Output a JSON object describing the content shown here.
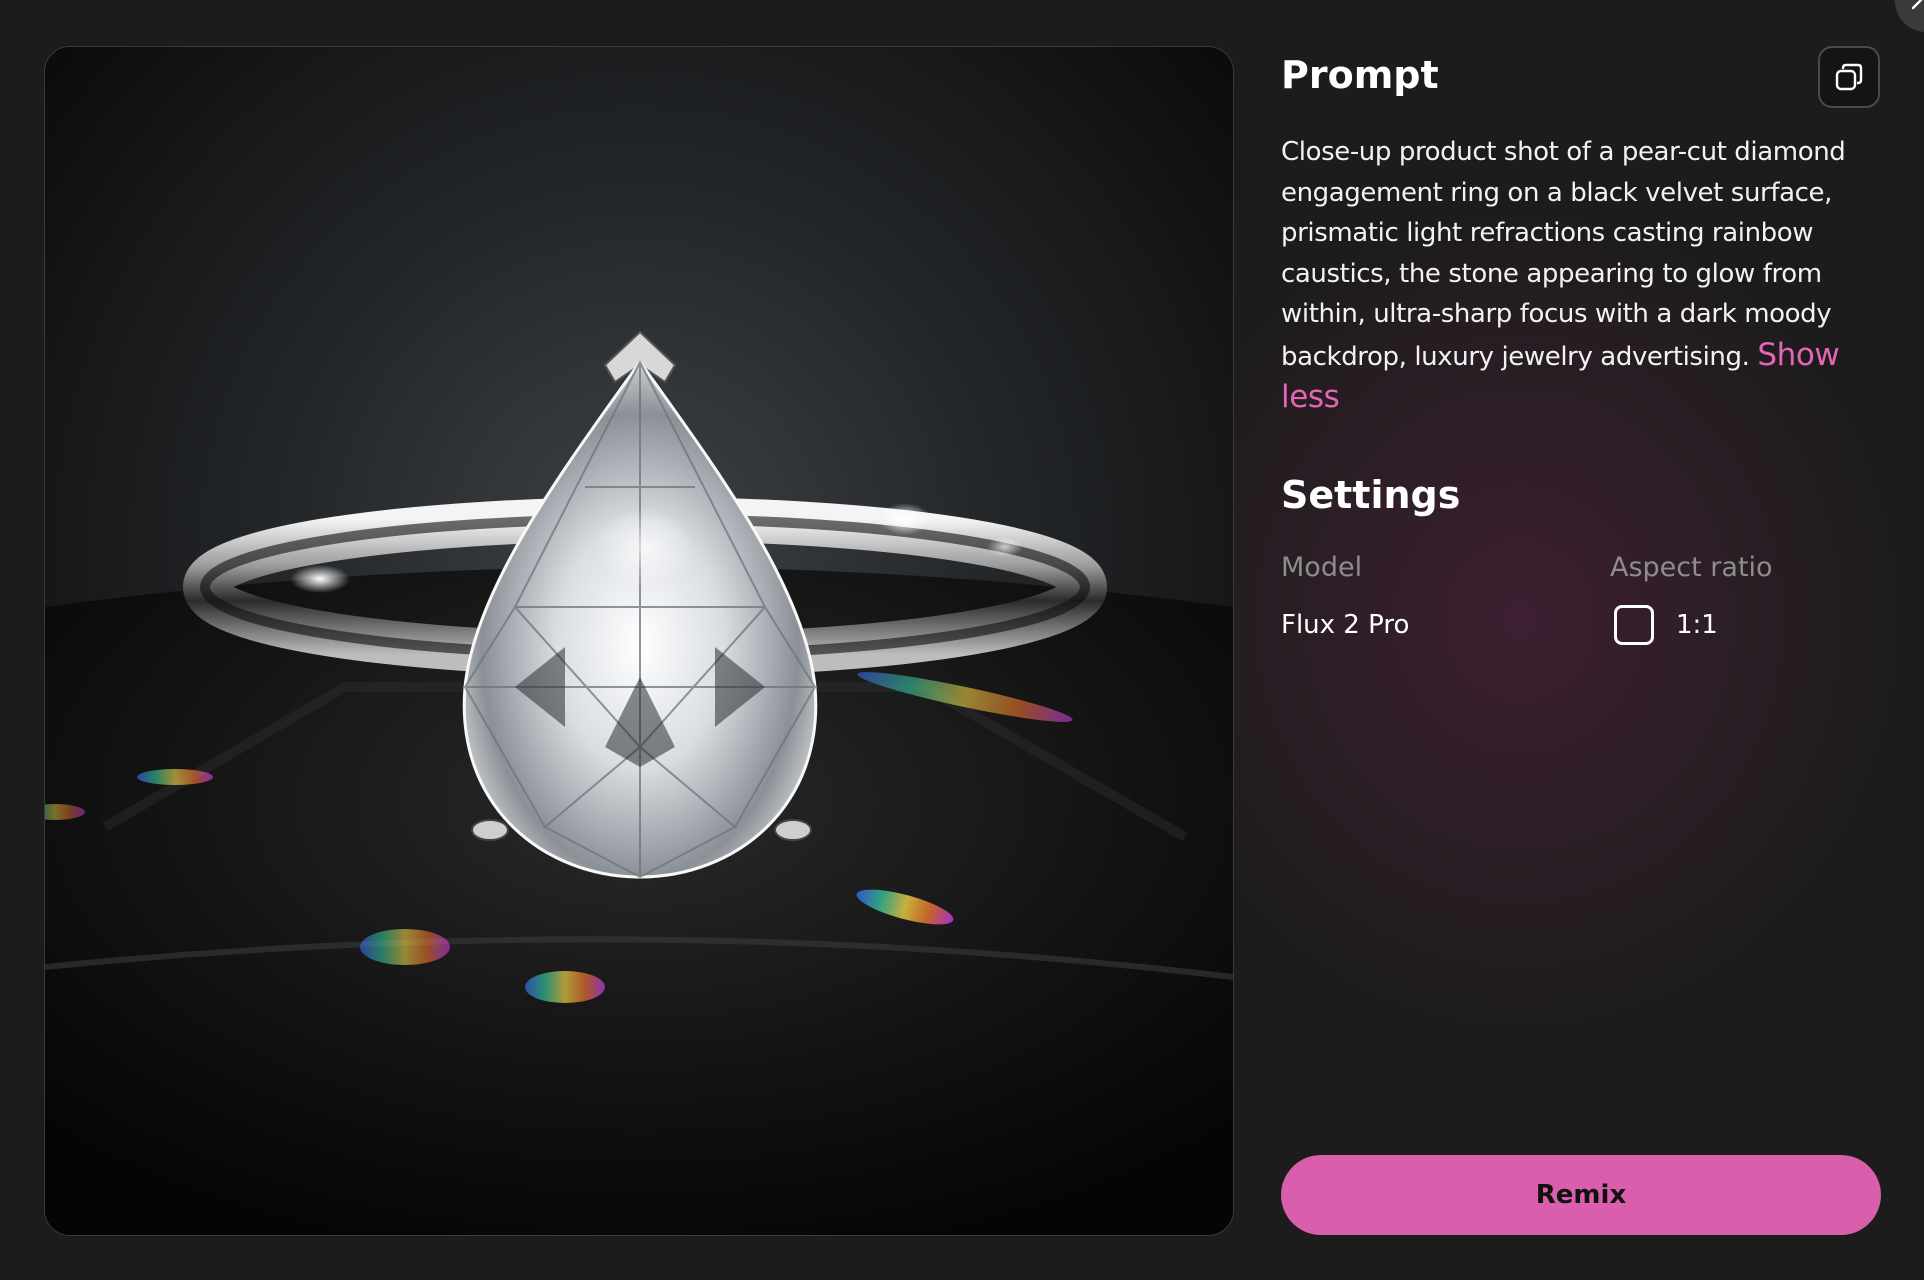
{
  "close_button": {
    "icon": "close-icon"
  },
  "image": {
    "alt": "Close-up of a pear-cut diamond ring on black velvet"
  },
  "prompt": {
    "title": "Prompt",
    "copy_icon": "copy-icon",
    "text": "Close-up product shot of a pear-cut diamond engagement ring on a black velvet surface, prismatic light refractions casting rainbow caustics, the stone appearing to glow from within, ultra-sharp focus with a dark moody backdrop, luxury jewelry advertising.",
    "toggle_label": "Show less"
  },
  "settings": {
    "title": "Settings",
    "model_label": "Model",
    "model_value": "Flux 2 Pro",
    "aspect_ratio_label": "Aspect ratio",
    "aspect_ratio_icon": "square-icon",
    "aspect_ratio_value": "1:1"
  },
  "actions": {
    "remix_label": "Remix"
  },
  "colors": {
    "background": "#1c1c1c",
    "accent": "#e565b5",
    "button": "#d95fac"
  }
}
